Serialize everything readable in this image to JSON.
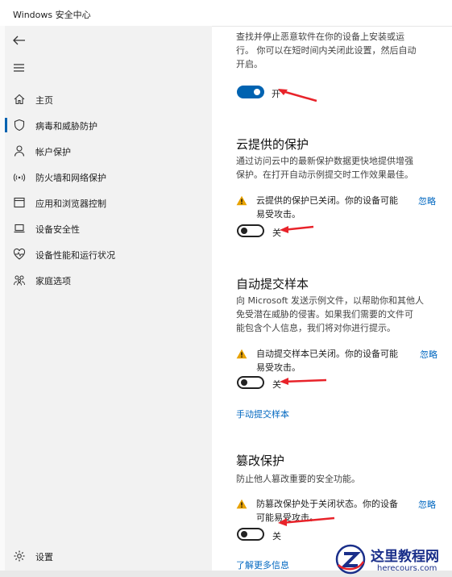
{
  "window": {
    "title": "Windows 安全中心"
  },
  "sidebar": {
    "items": [
      {
        "label": "主页",
        "icon": "home-icon"
      },
      {
        "label": "病毒和威胁防护",
        "icon": "shield-icon",
        "active": true
      },
      {
        "label": "帐户保护",
        "icon": "person-icon"
      },
      {
        "label": "防火墙和网络保护",
        "icon": "wifi-icon"
      },
      {
        "label": "应用和浏览器控制",
        "icon": "app-window-icon"
      },
      {
        "label": "设备安全性",
        "icon": "laptop-icon"
      },
      {
        "label": "设备性能和运行状况",
        "icon": "heart-icon"
      },
      {
        "label": "家庭选项",
        "icon": "family-icon"
      }
    ],
    "settings_label": "设置"
  },
  "content": {
    "realtime": {
      "desc_lines": [
        "查找并停止恶意软件在你的设备上安装或运",
        "行。 你可以在短时间内关闭此设置，然后自动",
        "开启。"
      ],
      "toggle_label": "开",
      "toggle_on": true
    },
    "cloud": {
      "title": "云提供的保护",
      "desc_lines": [
        "通过访问云中的最新保护数据更快地提供增强",
        "保护。在打开自动示例提交时工作效果最佳。"
      ],
      "warning_lines": [
        "云提供的保护已关闭。你的设备可能",
        "易受攻击。"
      ],
      "dismiss": "忽略",
      "toggle_label": "关",
      "toggle_on": false
    },
    "sample": {
      "title": "自动提交样本",
      "desc_lines": [
        "向 Microsoft 发送示例文件，以帮助你和其他人",
        "免受潜在威胁的侵害。如果我们需要的文件可",
        "能包含个人信息，我们将对你进行提示。"
      ],
      "warning_lines": [
        "自动提交样本已关闭。你的设备可能",
        "易受攻击。"
      ],
      "dismiss": "忽略",
      "toggle_label": "关",
      "toggle_on": false,
      "link": "手动提交样本"
    },
    "tamper": {
      "title": "篡改保护",
      "desc_lines": [
        "防止他人篡改重要的安全功能。"
      ],
      "warning_lines": [
        "防篡改保护处于关闭状态。你的设备",
        "可能易受攻击。"
      ],
      "dismiss": "忽略",
      "toggle_label": "关",
      "toggle_on": false,
      "link": "了解更多信息"
    }
  },
  "colors": {
    "accent": "#0063b1",
    "link": "#0067c0",
    "warning": "#e8a200",
    "annotation": "#e8232a"
  },
  "watermark": {
    "text": "这里教程网",
    "url": "herecours.com"
  }
}
